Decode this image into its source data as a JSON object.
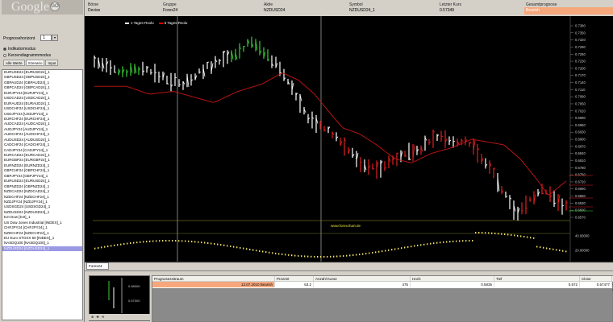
{
  "app": {
    "logo_text": "Google",
    "logo_btn": "GO"
  },
  "left_panel": {
    "prognose_label": "Prognosehorizont",
    "prognose_value": "1",
    "option_indicators": "Indikatormodus",
    "option_candles": "Kerzendiagrammmodus",
    "tabs": [
      "Alle Werte",
      "Szenario",
      "Input"
    ],
    "instruments": [
      "EURUSD24 [EURUSD24]_1",
      "GBPUSD24 [GBPUSD24]_1",
      "GBPAUD24 [GBPAUD24]_1",
      "GBPCAD24 [GBPCAD24]_1",
      "EURJPY24 [EURJPY24]_1",
      "USDCAD24 [USDCAD24]_1",
      "EURAUD24 [EURAUD24]_1",
      "USDCHF24 [USDCHF24]_1",
      "USDJPY24 [USDJPY24]_1",
      "EURCHF24 [EURCHF24]_1",
      "AUDCAD24 [AUDCAD24]_1",
      "AUDJPY24 [AUDJPY24]_1",
      "AUDCHF24 [AUDCHF24]_1",
      "AUDUSD24 [AUDUSD24]_1",
      "CADCHF24 [CADCHF24]_1",
      "CADJPY24 [CADJPY24]_1",
      "EURCAD24 [EURCAD24]_1",
      "EURGBP24 [EURGBP24]_1",
      "EURNZD24 [EURNZD24]_1",
      "GBPCHF24 [GBPCHF24]_1",
      "GBPJPY24 [GBPJPY24]_1",
      "EURUSD24 [EURUSD24]_1",
      "GBPNZD24 [GBPNZD24]_1",
      "NZDCAD24 [NZDCAD24]_1",
      "NZDCHF24 [NZDCHF24]_1",
      "NZDJPY24 [NZDJPY24]_1",
      "USDSGD24 [USDSGD24]_1",
      "NZDUSD24 [NZDUSD24]_1",
      "DJI Dow [DJI]_1",
      "US Dow Jones Industrial [INDEX]_1",
      "CHFJPY24 [CHFJPY24]_1",
      "NZDCHF24 [NZDCHF24]_1",
      "EU Euro STOXX 50 [INDEX]_1",
      "NASDQ100 [NASDQ100]_1",
      "NZDUSD24 [NZDUSD24]_1"
    ],
    "selected_index": 34
  },
  "info": {
    "headers": [
      "Börse",
      "Gruppe",
      "Aktie",
      "Symbol",
      "Letzter Kurs",
      "Gesamtprognose"
    ],
    "values": [
      "Devise",
      "Forex24",
      "NZDUSD24",
      "NZDUSD24_1",
      "0.57349",
      "Bearish"
    ],
    "signal_color": "#f6a77c"
  },
  "legend": {
    "series1": "1 Tages-Rsolu",
    "series2": "5 Tages-Rsolu"
  },
  "chart_data": {
    "type": "candlestick",
    "price_axis": [
      "0.7380",
      "0.7350",
      "0.7320",
      "0.7290",
      "0.7260",
      "0.7230",
      "0.7200",
      "0.7170",
      "0.7140",
      "0.7110",
      "0.7080",
      "0.7050",
      "0.7020",
      "0.6990",
      "0.6960",
      "0.6930",
      "0.6900",
      "0.6870",
      "0.6840",
      "0.6810",
      "0.6780",
      "0.6750",
      "0.6720",
      "0.6690",
      "0.6660",
      "0.6630",
      "0.6600",
      "0.6570"
    ],
    "osc_axis": [
      "40.00000",
      "20.00000"
    ],
    "date_labels": [
      "Feb 24",
      "Mar 03",
      "Mar 10",
      "Mar 17",
      "Mar 24",
      "Apr 07",
      "Apr 14",
      "Apr 21",
      "Apr 28",
      "May 05",
      "May 12",
      "May 19",
      "May 26",
      "Jun 02",
      "Jun 09",
      "Jun 16",
      "Jun 23",
      "Jun 30",
      "Jul 07",
      "Jul 14",
      "Jul 21",
      "Jul 28",
      "Aug 04",
      "Aug 11",
      "Aug 18",
      "Aug 25",
      "Sep 01",
      "Sep 08",
      "Sep 15",
      "Sep 22"
    ],
    "watermark": "www.forexchart.de"
  },
  "bottom": {
    "tab_label": "Forex24",
    "grid_headers": [
      "Prognosezeitraum",
      "Prozent",
      "Anzahl Kurse",
      "Hoch",
      "Tief",
      "Close",
      "Erwartung"
    ],
    "grid_values": [
      "13.07.2010 Bearish",
      "63.2",
      "475",
      "0.5835",
      "0.572",
      "0.57477",
      "-0.63 %"
    ],
    "mini_axis": [
      "0.58000",
      "0.57000"
    ]
  }
}
